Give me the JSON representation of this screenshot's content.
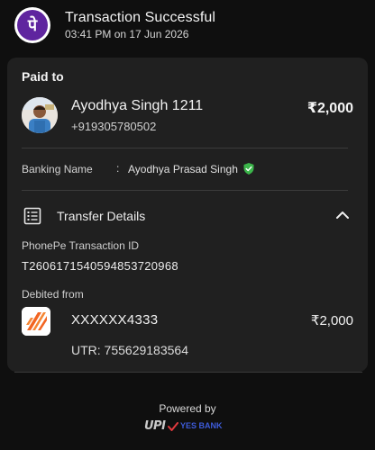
{
  "header": {
    "title": "Transaction Successful",
    "datetime": "03:41 PM on 17 Jun 2026",
    "logo_glyph": "पे",
    "logo_color": "#5f259f"
  },
  "card": {
    "paid_to_label": "Paid to",
    "payee": {
      "name": "Ayodhya Singh 1211",
      "phone": "+919305780502",
      "amount": "₹2,000"
    },
    "banking_name_label": "Banking Name",
    "banking_name_separator": ":",
    "banking_name": "Ayodhya Prasad Singh",
    "verified_color": "#3bb54a",
    "transfer_details": {
      "title": "Transfer Details",
      "expanded": true,
      "txn_id_label": "PhonePe Transaction ID",
      "txn_id": "T2606171540594853720968",
      "debited_label": "Debited from",
      "account": "XXXXXX4333",
      "debit_amount": "₹2,000",
      "utr": "UTR: 755629183564",
      "bank_brand_color": "#f26522"
    }
  },
  "footer": {
    "powered_by": "Powered by",
    "upi_text": "UPI",
    "bank_text": "YES BANK"
  }
}
